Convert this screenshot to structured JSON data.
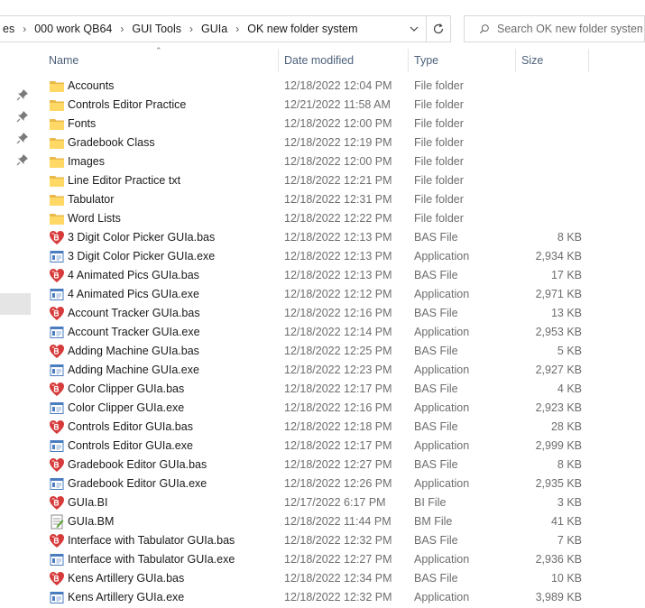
{
  "breadcrumb": [
    "es",
    "000 work QB64",
    "GUI Tools",
    "GUIa",
    "OK new folder system"
  ],
  "search": {
    "placeholder": "Search OK new folder system"
  },
  "columns": {
    "name": "Name",
    "date": "Date modified",
    "type": "Type",
    "size": "Size"
  },
  "files": [
    {
      "name": "Accounts",
      "date": "12/18/2022 12:04 PM",
      "type": "File folder",
      "size": "",
      "icon": "folder-icon"
    },
    {
      "name": "Controls Editor Practice",
      "date": "12/21/2022 11:58 AM",
      "type": "File folder",
      "size": "",
      "icon": "folder-icon"
    },
    {
      "name": "Fonts",
      "date": "12/18/2022 12:00 PM",
      "type": "File folder",
      "size": "",
      "icon": "folder-icon"
    },
    {
      "name": "Gradebook Class",
      "date": "12/18/2022 12:19 PM",
      "type": "File folder",
      "size": "",
      "icon": "folder-icon"
    },
    {
      "name": "Images",
      "date": "12/18/2022 12:00 PM",
      "type": "File folder",
      "size": "",
      "icon": "folder-icon"
    },
    {
      "name": "Line Editor Practice txt",
      "date": "12/18/2022 12:21 PM",
      "type": "File folder",
      "size": "",
      "icon": "folder-icon"
    },
    {
      "name": "Tabulator",
      "date": "12/18/2022 12:31 PM",
      "type": "File folder",
      "size": "",
      "icon": "folder-icon"
    },
    {
      "name": "Word Lists",
      "date": "12/18/2022 12:22 PM",
      "type": "File folder",
      "size": "",
      "icon": "folder-icon"
    },
    {
      "name": "3 Digit Color Picker GUIa.bas",
      "date": "12/18/2022 12:13 PM",
      "type": "BAS File",
      "size": "8 KB",
      "icon": "bas-file-icon"
    },
    {
      "name": "3 Digit Color Picker GUIa.exe",
      "date": "12/18/2022 12:13 PM",
      "type": "Application",
      "size": "2,934 KB",
      "icon": "application-icon"
    },
    {
      "name": "4 Animated Pics GUIa.bas",
      "date": "12/18/2022 12:13 PM",
      "type": "BAS File",
      "size": "17 KB",
      "icon": "bas-file-icon"
    },
    {
      "name": "4 Animated Pics GUIa.exe",
      "date": "12/18/2022 12:12 PM",
      "type": "Application",
      "size": "2,971 KB",
      "icon": "application-icon"
    },
    {
      "name": "Account Tracker GUIa.bas",
      "date": "12/18/2022 12:16 PM",
      "type": "BAS File",
      "size": "13 KB",
      "icon": "bas-file-icon"
    },
    {
      "name": "Account Tracker GUIa.exe",
      "date": "12/18/2022 12:14 PM",
      "type": "Application",
      "size": "2,953 KB",
      "icon": "application-icon"
    },
    {
      "name": "Adding Machine GUIa.bas",
      "date": "12/18/2022 12:25 PM",
      "type": "BAS File",
      "size": "5 KB",
      "icon": "bas-file-icon"
    },
    {
      "name": "Adding Machine GUIa.exe",
      "date": "12/18/2022 12:23 PM",
      "type": "Application",
      "size": "2,927 KB",
      "icon": "application-icon"
    },
    {
      "name": "Color Clipper GUIa.bas",
      "date": "12/18/2022 12:17 PM",
      "type": "BAS File",
      "size": "4 KB",
      "icon": "bas-file-icon"
    },
    {
      "name": "Color Clipper GUIa.exe",
      "date": "12/18/2022 12:16 PM",
      "type": "Application",
      "size": "2,923 KB",
      "icon": "application-icon"
    },
    {
      "name": "Controls Editor GUIa.bas",
      "date": "12/18/2022 12:18 PM",
      "type": "BAS File",
      "size": "28 KB",
      "icon": "bas-file-icon"
    },
    {
      "name": "Controls Editor GUIa.exe",
      "date": "12/18/2022 12:17 PM",
      "type": "Application",
      "size": "2,999 KB",
      "icon": "application-icon"
    },
    {
      "name": "Gradebook Editor GUIa.bas",
      "date": "12/18/2022 12:27 PM",
      "type": "BAS File",
      "size": "8 KB",
      "icon": "bas-file-icon"
    },
    {
      "name": "Gradebook Editor GUIa.exe",
      "date": "12/18/2022 12:26 PM",
      "type": "Application",
      "size": "2,935 KB",
      "icon": "application-icon"
    },
    {
      "name": "GUIa.BI",
      "date": "12/17/2022 6:17 PM",
      "type": "BI File",
      "size": "3 KB",
      "icon": "bas-file-icon"
    },
    {
      "name": "GUIa.BM",
      "date": "12/18/2022 11:44 PM",
      "type": "BM File",
      "size": "41 KB",
      "icon": "bm-file-icon"
    },
    {
      "name": "Interface with Tabulator GUIa.bas",
      "date": "12/18/2022 12:32 PM",
      "type": "BAS File",
      "size": "7 KB",
      "icon": "bas-file-icon"
    },
    {
      "name": "Interface with Tabulator GUIa.exe",
      "date": "12/18/2022 12:27 PM",
      "type": "Application",
      "size": "2,936 KB",
      "icon": "application-icon"
    },
    {
      "name": "Kens Artillery GUIa.bas",
      "date": "12/18/2022 12:34 PM",
      "type": "BAS File",
      "size": "10 KB",
      "icon": "bas-file-icon"
    },
    {
      "name": "Kens Artillery GUIa.exe",
      "date": "12/18/2022 12:32 PM",
      "type": "Application",
      "size": "3,989 KB",
      "icon": "application-icon"
    }
  ]
}
